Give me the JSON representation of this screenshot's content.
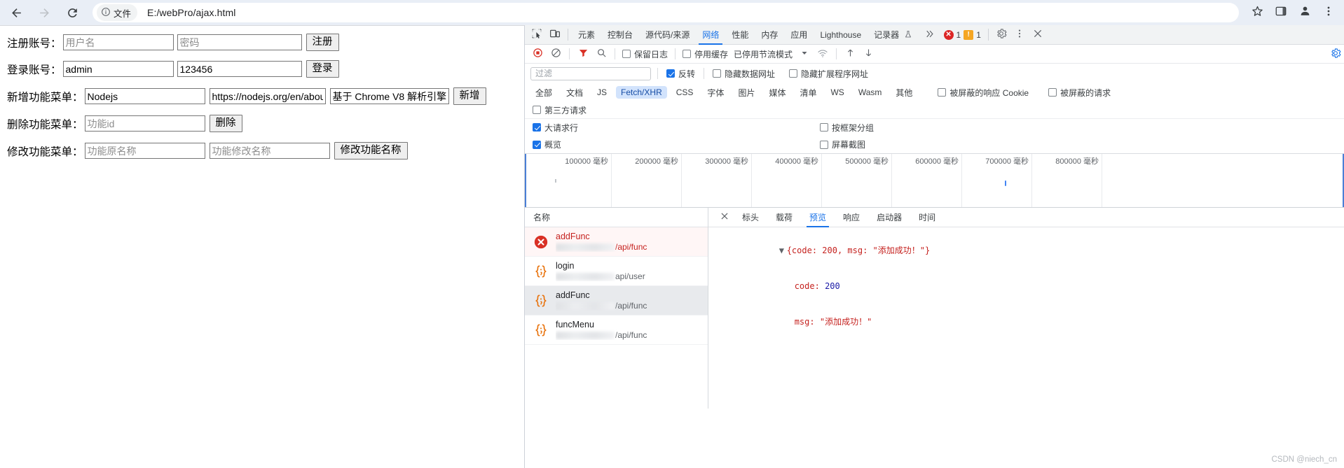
{
  "browser": {
    "back_icon": "back-arrow-icon",
    "forward_icon": "forward-arrow-icon",
    "reload_icon": "reload-icon",
    "site_chip_label": "文件",
    "url": "E:/webPro/ajax.html",
    "bookmark_icon": "star-icon",
    "sidepanel_icon": "side-panel-icon",
    "profile_icon": "profile-icon",
    "menu_icon": "kebab-menu-icon"
  },
  "page": {
    "rows": [
      {
        "label": "注册账号：",
        "field1_value": "",
        "field1_placeholder": "用户名",
        "field2_value": "",
        "field2_placeholder": "密码",
        "button": "注册"
      },
      {
        "label": "登录账号：",
        "field1_value": "admin",
        "field1_placeholder": "",
        "field2_value": "123456",
        "field2_placeholder": "",
        "button": "登录"
      },
      {
        "label": "新增功能菜单：",
        "field1_value": "Nodejs",
        "field1_placeholder": "",
        "field2_value": "https://nodejs.org/en/about",
        "field2_placeholder": "",
        "field3_value": "基于 Chrome V8 解析引擎",
        "field3_placeholder": "",
        "button": "新增"
      },
      {
        "label": "删除功能菜单：",
        "field1_value": "",
        "field1_placeholder": "功能id",
        "button": "删除"
      },
      {
        "label": "修改功能菜单：",
        "field1_value": "",
        "field1_placeholder": "功能原名称",
        "field2_value": "",
        "field2_placeholder": "功能修改名称",
        "button": "修改功能名称"
      }
    ]
  },
  "devtools": {
    "inspect_icon": "inspect-element-icon",
    "device_icon": "device-toolbar-icon",
    "tabs": [
      {
        "label": "元素",
        "active": false
      },
      {
        "label": "控制台",
        "active": false
      },
      {
        "label": "源代码/来源",
        "active": false
      },
      {
        "label": "网络",
        "active": true
      },
      {
        "label": "性能",
        "active": false
      },
      {
        "label": "内存",
        "active": false
      },
      {
        "label": "应用",
        "active": false
      },
      {
        "label": "Lighthouse",
        "active": false
      },
      {
        "label": "记录器",
        "active": false
      }
    ],
    "recorder_flask_icon": "flask-icon",
    "more_tabs_icon": "chevron-double-right-icon",
    "error_count": "1",
    "warning_count": "1",
    "settings_icon": "gear-icon",
    "overflow_icon": "kebab-menu-icon",
    "close_icon": "close-icon",
    "toolbar": {
      "record_icon": "record-stop-icon",
      "clear_icon": "clear-icon",
      "filter_icon": "filter-funnel-icon",
      "search_icon": "search-icon",
      "preserve_log": "保留日志",
      "preserve_log_checked": false,
      "disable_cache": "停用缓存",
      "disable_cache_checked": false,
      "throttling": "已停用节流模式",
      "throttle_caret_icon": "chevron-down-icon",
      "wifi_icon": "network-conditions-icon",
      "import_icon": "upload-har-icon",
      "export_icon": "download-har-icon",
      "settings_icon": "gear-blue-icon"
    },
    "filter": {
      "placeholder": "过滤",
      "value": "",
      "invert_label": "反转",
      "invert_checked": true,
      "hide_data_urls": "隐藏数据网址",
      "hide_data_urls_checked": false,
      "hide_ext_urls": "隐藏扩展程序网址",
      "hide_ext_urls_checked": false
    },
    "types": [
      {
        "label": "全部",
        "selected": false
      },
      {
        "label": "文档",
        "selected": false
      },
      {
        "label": "JS",
        "selected": false
      },
      {
        "label": "Fetch/XHR",
        "selected": true
      },
      {
        "label": "CSS",
        "selected": false
      },
      {
        "label": "字体",
        "selected": false
      },
      {
        "label": "图片",
        "selected": false
      },
      {
        "label": "媒体",
        "selected": false
      },
      {
        "label": "清单",
        "selected": false
      },
      {
        "label": "WS",
        "selected": false
      },
      {
        "label": "Wasm",
        "selected": false
      },
      {
        "label": "其他",
        "selected": false
      }
    ],
    "type_extras": [
      {
        "label": "被屏蔽的响应 Cookie",
        "checked": false
      },
      {
        "label": "被屏蔽的请求",
        "checked": false
      }
    ],
    "third_party": {
      "label": "第三方请求",
      "checked": false
    },
    "options": [
      {
        "label": "大请求行",
        "checked": true
      },
      {
        "label": "按框架分组",
        "checked": false
      },
      {
        "label": "概览",
        "checked": true
      },
      {
        "label": "屏幕截图",
        "checked": false
      }
    ],
    "overview": {
      "ticks": [
        "100000 毫秒",
        "200000 毫秒",
        "300000 毫秒",
        "400000 毫秒",
        "500000 毫秒",
        "600000 毫秒",
        "700000 毫秒",
        "800000 毫秒"
      ]
    },
    "requests": {
      "header": "名称",
      "items": [
        {
          "name": "addFunc",
          "url_tail": "/api/func",
          "status": "error",
          "icon": "error-circle-icon",
          "selected": false
        },
        {
          "name": "login",
          "url_tail": "api/user",
          "status": "ok",
          "icon": "json-braces-icon",
          "selected": false
        },
        {
          "name": "addFunc",
          "url_tail": "/api/func",
          "status": "ok",
          "icon": "json-braces-icon",
          "selected": true
        },
        {
          "name": "funcMenu",
          "url_tail": "/api/func",
          "status": "ok",
          "icon": "json-braces-icon",
          "selected": false
        }
      ]
    },
    "detail": {
      "close_icon": "close-icon",
      "tabs": [
        {
          "label": "标头",
          "active": false
        },
        {
          "label": "载荷",
          "active": false
        },
        {
          "label": "预览",
          "active": true
        },
        {
          "label": "响应",
          "active": false
        },
        {
          "label": "启动器",
          "active": false
        },
        {
          "label": "时间",
          "active": false
        }
      ],
      "preview": {
        "root": "{code: 200, msg: \"添加成功！\"}",
        "lines": [
          {
            "key": "code:",
            "value": "200",
            "type": "number"
          },
          {
            "key": "msg:",
            "value": "\"添加成功！\"",
            "type": "string"
          }
        ]
      }
    }
  },
  "watermark": "CSDN @niech_cn"
}
